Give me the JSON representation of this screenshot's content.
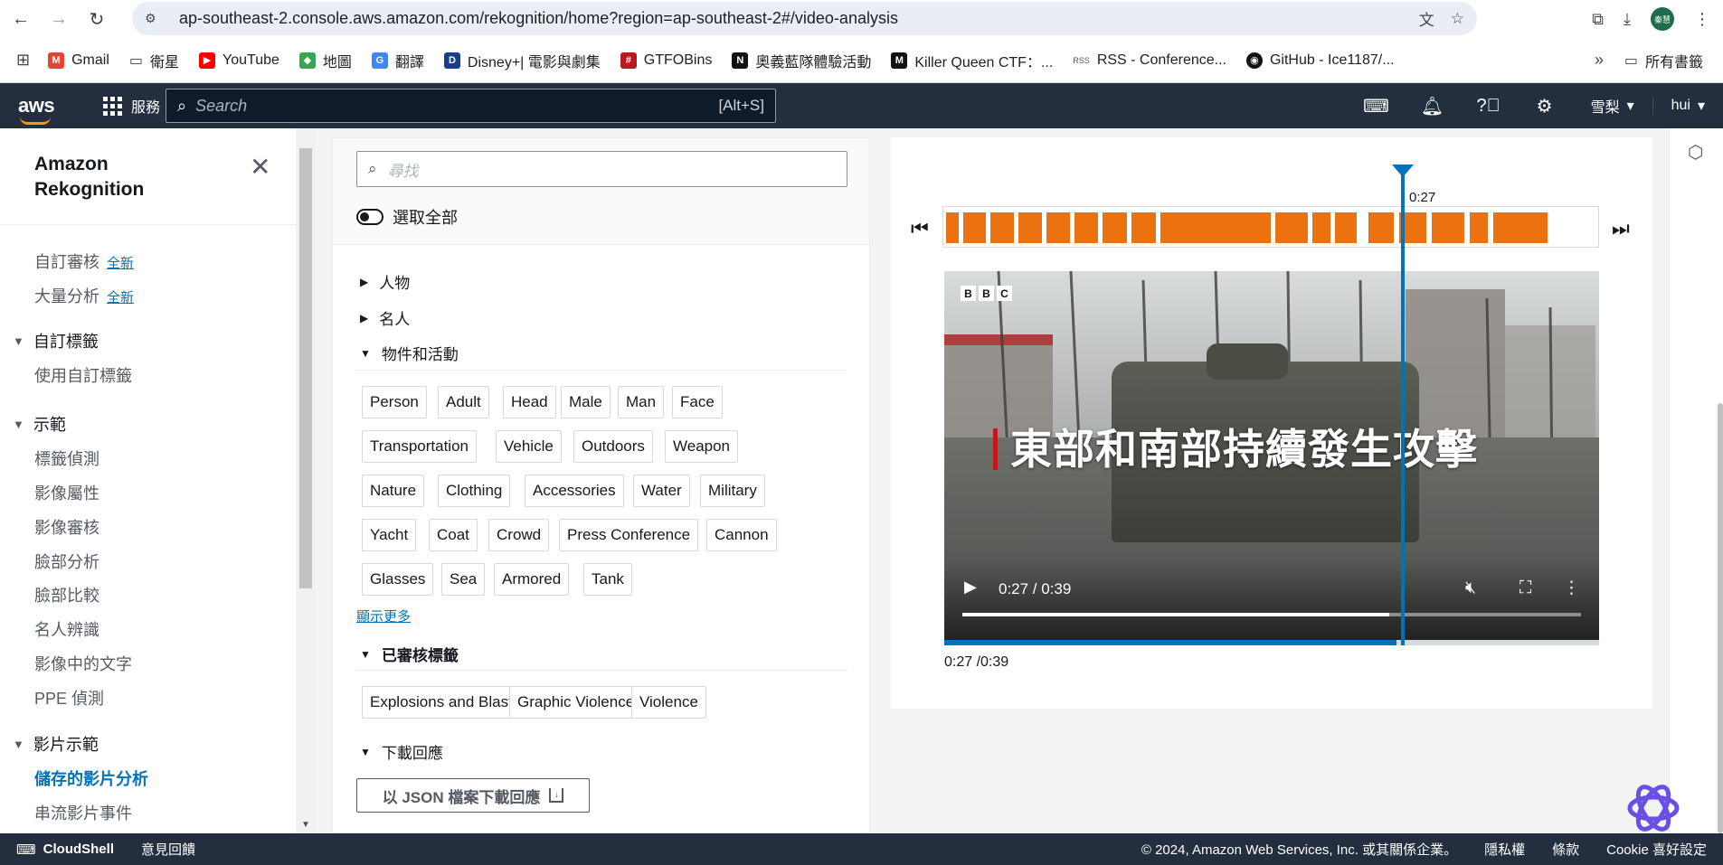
{
  "browser": {
    "url": "ap-southeast-2.console.aws.amazon.com/rekognition/home?region=ap-southeast-2#/video-analysis",
    "avatar_text": "秦慧",
    "bookmarks": [
      "Gmail",
      "衛星",
      "YouTube",
      "地圖",
      "翻譯",
      "Disney+| 電影與劇集",
      "GTFOBins",
      "奧義藍隊體驗活動",
      "Killer Queen CTF：...",
      "RSS - Conference...",
      "GitHub - Ice1187/..."
    ],
    "bookmarks_all": "所有書籤"
  },
  "aws": {
    "logo": "aws",
    "services_label": "服務",
    "search_placeholder": "Search",
    "search_shortcut": "[Alt+S]",
    "region": "雪梨",
    "user": "hui"
  },
  "sidebar": {
    "title_line1": "Amazon",
    "title_line2": "Rekognition",
    "new_badge": "全新",
    "items_top": [
      "自訂審核",
      "大量分析"
    ],
    "custom_labels_section": "自訂標籤",
    "custom_labels_items": [
      "使用自訂標籤"
    ],
    "demos_section": "示範",
    "demos_items": [
      "標籤偵測",
      "影像屬性",
      "影像審核",
      "臉部分析",
      "臉部比較",
      "名人辨識",
      "影像中的文字",
      "PPE 偵測"
    ],
    "video_section": "影片示範",
    "video_items": [
      "儲存的影片分析",
      "串流影片事件"
    ]
  },
  "filter": {
    "search_placeholder": "尋找",
    "select_all": "選取全部",
    "sec_people": "人物",
    "sec_celebs": "名人",
    "sec_objects": "物件和活動",
    "object_labels": [
      "Person",
      "Adult",
      "Head",
      "Male",
      "Man",
      "Face",
      "Transportation",
      "Vehicle",
      "Outdoors",
      "Weapon",
      "Nature",
      "Clothing",
      "Accessories",
      "Water",
      "Military",
      "Yacht",
      "Coat",
      "Crowd",
      "Press Conference",
      "Cannon",
      "Glasses",
      "Sea",
      "Armored",
      "Tank"
    ],
    "show_more": "顯示更多",
    "sec_moderation": "已審核標籤",
    "moderation_labels": [
      "Explosions and Blasts",
      "Graphic Violence",
      "Violence"
    ],
    "sec_download": "下載回應",
    "download_button": "以 JSON 檔案下載回應"
  },
  "video": {
    "playhead_label": "0:27",
    "bbc_letters": [
      "B",
      "B",
      "C"
    ],
    "caption": "東部和南部持續發生攻擊",
    "player_time": "0:27 / 0:39",
    "progress": 0.69,
    "time_readout": "0:27 /0:39"
  },
  "footer": {
    "cloudshell": "CloudShell",
    "feedback": "意見回饋",
    "copyright": "© 2024, Amazon Web Services, Inc. 或其關係企業。",
    "privacy": "隱私權",
    "terms": "條款",
    "cookie": "Cookie 喜好設定"
  },
  "colors": {
    "aws_nav": "#232f3e",
    "accent_orange": "#ec7211",
    "link_blue": "#0073bb"
  }
}
